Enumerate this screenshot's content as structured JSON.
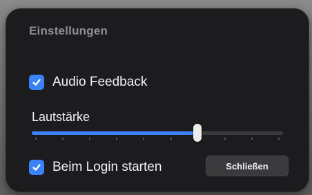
{
  "window": {
    "title": "Einstellungen"
  },
  "settings": {
    "audio_feedback": {
      "label": "Audio Feedback",
      "checked": true
    },
    "volume": {
      "label": "Lautstärke",
      "value_fraction": 0.66,
      "tick_count": 10
    },
    "start_at_login": {
      "label": "Beim Login starten",
      "checked": true
    },
    "close_button_label": "Schließen"
  },
  "colors": {
    "accent": "#3a82f7",
    "panel_background": "#1c1c1e",
    "title_text": "#8e8e93"
  },
  "icons": {
    "checkmark": "checkmark-icon"
  }
}
